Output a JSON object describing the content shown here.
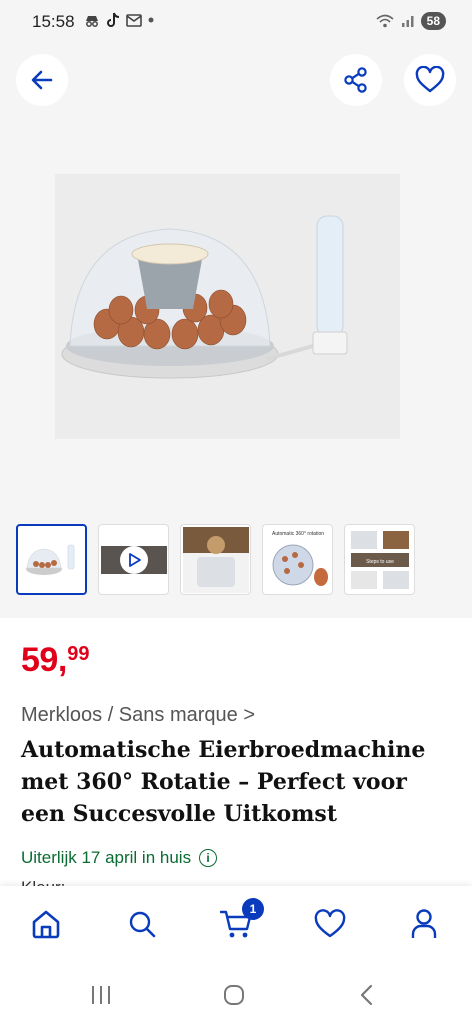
{
  "status_bar": {
    "time": "15:58",
    "battery": "58"
  },
  "gallery": {
    "thumbnails": [
      {
        "name": "incubator"
      },
      {
        "name": "video"
      },
      {
        "name": "detail"
      },
      {
        "name": "rotation",
        "caption": "Automatic 360° rotation"
      },
      {
        "name": "steps",
        "caption": "Steps to use"
      }
    ]
  },
  "product": {
    "price_whole": "59",
    "price_separator": ",",
    "price_cents": "99",
    "brand": "Merkloos / Sans marque",
    "brand_chevron": ">",
    "title": "Automatische Eierbroedmachine met 360° Rotatie – Perfect voor een Succesvolle Uitkomst",
    "delivery": "Uiterlijk 17 april in huis",
    "next_label_partial": "Kleur:"
  },
  "bottom_nav": {
    "cart_count": "1",
    "active": "home"
  },
  "colors": {
    "brand_blue": "#0a3bbd",
    "price_red": "#e0001a",
    "delivery_green": "#0b6b33"
  },
  "icons": [
    "arrow-left-icon",
    "share-icon",
    "heart-icon",
    "play-icon",
    "info-icon",
    "home-icon",
    "search-icon",
    "cart-icon",
    "heart-icon",
    "user-icon",
    "recent-apps-icon",
    "home-circle-icon",
    "back-chevron-icon"
  ]
}
